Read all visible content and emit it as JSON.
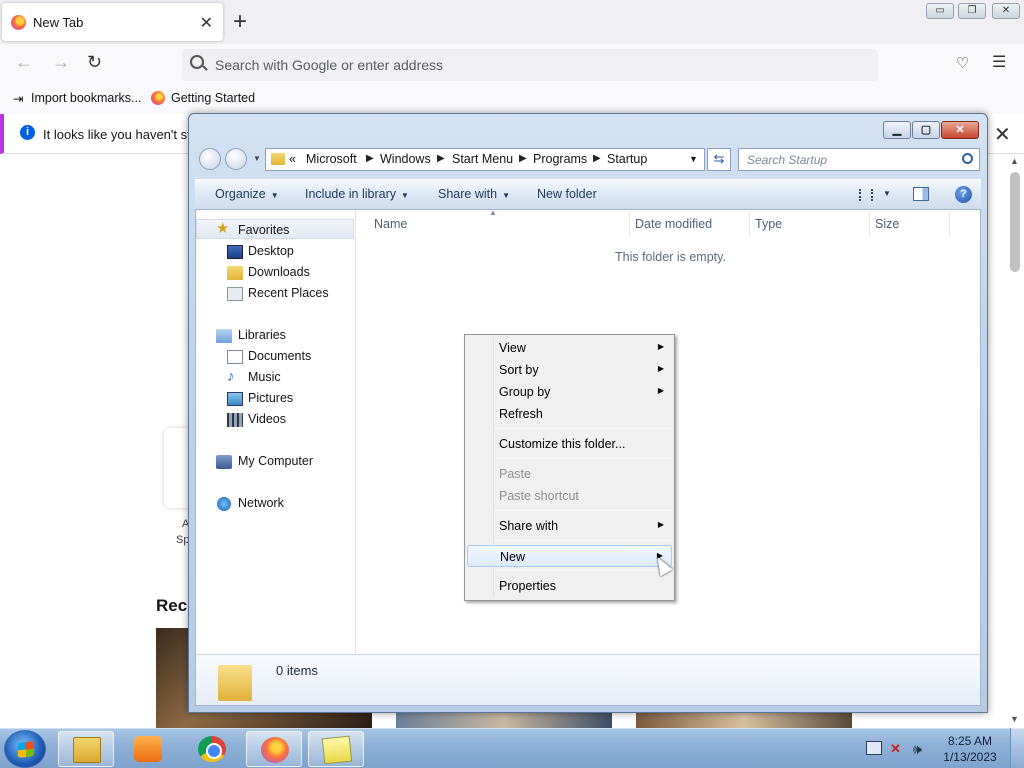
{
  "browser": {
    "tab_title": "New Tab",
    "tab_close": "✕",
    "new_tab": "+",
    "url_placeholder": "Search with Google or enter address",
    "bookmarks": [
      "Import bookmarks...",
      "Getting Started"
    ],
    "notice_text": "It looks like you haven't star",
    "recent_heading": "Reco",
    "tile_labels": [
      "A",
      "Sp"
    ],
    "window_buttons": [
      "▭",
      "❐",
      "✕"
    ]
  },
  "explorer": {
    "breadcrumb_prefix": "«",
    "breadcrumbs": [
      "Microsoft",
      "Windows",
      "Start Menu",
      "Programs",
      "Startup"
    ],
    "search_placeholder": "Search Startup",
    "toolbar": {
      "organize": "Organize",
      "include_in_library": "Include in library",
      "share_with": "Share with",
      "new_folder": "New folder"
    },
    "nav": {
      "favorites": "Favorites",
      "desktop": "Desktop",
      "downloads": "Downloads",
      "recent_places": "Recent Places",
      "libraries": "Libraries",
      "documents": "Documents",
      "music": "Music",
      "pictures": "Pictures",
      "videos": "Videos",
      "my_computer": "My Computer",
      "network": "Network"
    },
    "columns": [
      "Name",
      "Date modified",
      "Type",
      "Size"
    ],
    "empty_text": "This folder is empty.",
    "item_count": "0 items",
    "help": "?"
  },
  "context_menu": {
    "view": "View",
    "sort_by": "Sort by",
    "group_by": "Group by",
    "refresh": "Refresh",
    "customize": "Customize this folder...",
    "paste": "Paste",
    "paste_shortcut": "Paste shortcut",
    "share_with": "Share with",
    "new": "New",
    "properties": "Properties",
    "submenu_arrow": "▶",
    "highlighted": "New"
  },
  "taskbar": {
    "time": "8:25 AM",
    "date": "1/13/2023",
    "active_app": "explorer"
  },
  "colors": {
    "explorer_frame": "#bfd3ea",
    "menu_bg": "#f0f0f0",
    "menu_highlight": "#dcebfc",
    "taskbar": "#8fb1d7",
    "firefox_accent": "#b833e1"
  }
}
